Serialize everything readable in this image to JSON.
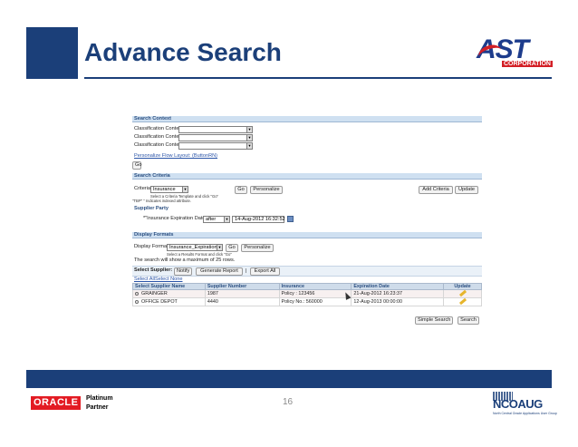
{
  "slide": {
    "title": "Advance Search",
    "page_number": "16"
  },
  "logos": {
    "ast": {
      "name": "AST",
      "sub": "CORPORATION"
    },
    "oracle": {
      "name": "ORACLE",
      "badge_line1": "Platinum",
      "badge_line2": "Partner"
    },
    "ncoaug": {
      "name": "NCOAUG",
      "tagline": "North Central Oracle Applications User Group"
    }
  },
  "colors": {
    "primary": "#1b3f79",
    "accent_red": "#d31f26",
    "oracle_red": "#e31b23"
  },
  "screenshot": {
    "search_context": {
      "header": "Search Context",
      "rows": [
        "Classification Context",
        "Classification Context",
        "Classification Context"
      ],
      "personalize_link": "Personalize Flow Layout: (ButtonRN)",
      "go_button": "Go"
    },
    "search_criteria": {
      "header": "Search Criteria",
      "criteria_label": "Criteria",
      "criteria_value": "Insurance",
      "criteria_note": "Select a Criteria Template and click \"Go\"",
      "indexed_note": "\"TBP\" \"  Indicates indexed attribute.",
      "go_button": "Go",
      "personalize_button": "Personalize",
      "add_criteria_button": "Add Criteria",
      "update_button": "Update",
      "supplier_party_label": "Supplier Party",
      "attribute_label": "*\"Insurance Expiration Date",
      "operator": "after",
      "date_value": "14-Aug-2012 16:32:52"
    },
    "display_formats": {
      "header": "Display Formats",
      "label": "Display Formats",
      "value": "Insurance_Expiration",
      "note": "Select a Results Format and click \"Go\"",
      "go_button": "Go",
      "personalize_button": "Personalize",
      "max_rows_text": "The search will show a maximum of 25 rows."
    },
    "results": {
      "select_supplier_label": "Select Supplier:",
      "notify_button": "Notify",
      "generate_report_button": "Generate Report",
      "separator": "|",
      "export_all_button": "Export All",
      "select_all_link": "Select All",
      "select_none_link": "Select None",
      "columns": [
        "Select Supplier Name",
        "Supplier Number",
        "Insurance",
        "Expiration Date",
        "Update"
      ],
      "rows": [
        {
          "name": "GRAINGER",
          "number": "1987",
          "insurance": "Policy : 123456",
          "expiration": "21-Aug-2012 16:23:37"
        },
        {
          "name": "OFFICE DEPOT",
          "number": "4440",
          "insurance": "Policy No.: 560000",
          "expiration": "12-Aug-2013 00:00:00"
        }
      ],
      "simple_search_button": "Simple Search",
      "search_button": "Search"
    }
  }
}
